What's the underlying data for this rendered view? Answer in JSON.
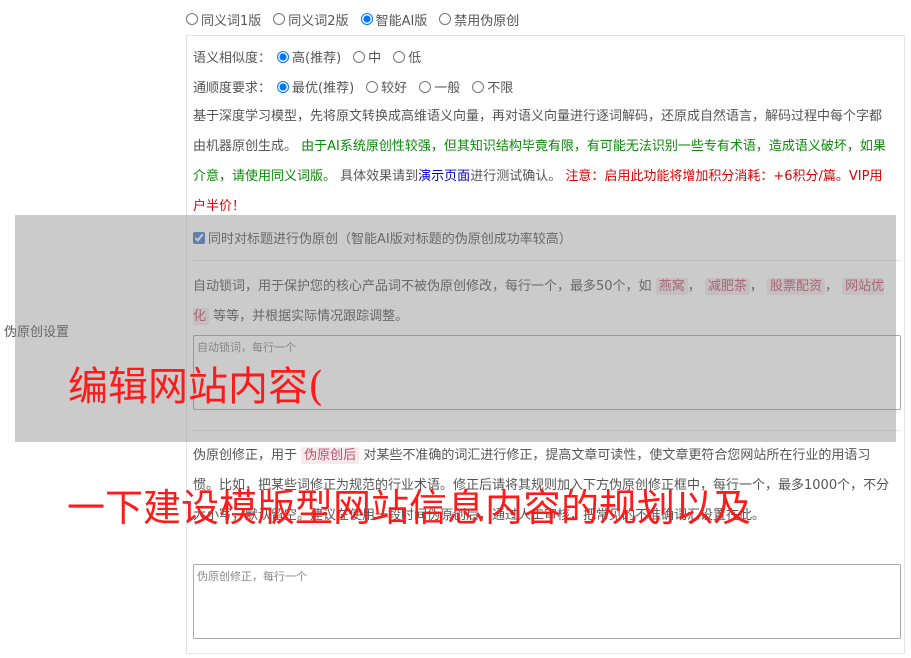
{
  "side_label": "伪原创设置",
  "versions": {
    "name": "version",
    "selected_index": 2,
    "options": [
      "同义词1版",
      "同义词2版",
      "智能AI版",
      "禁用伪原创"
    ]
  },
  "similarity": {
    "label": "语义相似度：",
    "selected_index": 0,
    "options": [
      "高(推荐)",
      "中",
      "低"
    ]
  },
  "fluency": {
    "label": "通顺度要求：",
    "selected_index": 0,
    "options": [
      "最优(推荐)",
      "较好",
      "一般",
      "不限"
    ]
  },
  "ai_desc": {
    "part1": "基于深度学习模型，先将原文转换成高维语义向量，再对语义向量进行逐词解码，还原成自然语言，解码过程中每个字都由机器原创生成。",
    "part2": "由于AI系统原创性较强，但其知识结构毕竟有限，有可能无法识别一些专有术语，造成语义破坏，如果介意，请使用同义词版。",
    "part3": "具体效果请到",
    "link": "演示页面",
    "part4": "进行测试确认。",
    "part5": "注意：启用此功能将增加积分消耗：+6积分/篇。VIP用户半价！"
  },
  "title_check": {
    "label": "同时对标题进行伪原创（智能AI版对标题的伪原创成功率较高）",
    "checked": true
  },
  "lock_words": {
    "desc_before": "自动锁词，用于保护您的核心产品词不被伪原创修改，每行一个，最多50个，如",
    "examples": [
      "燕窝",
      "减肥茶",
      "股票配资",
      "网站优化"
    ],
    "desc_after": "等等，并根据实际情况跟踪调整。",
    "placeholder": "自动锁词，每行一个"
  },
  "correction": {
    "desc_before": "伪原创修正，用于",
    "tag": "伪原创后",
    "desc_after": "对某些不准确的词汇进行修正，提高文章可读性，使文章更符合您网站所在行业的用语习惯。比如，把某些词修正为规范的行业术语。修正后请将其规则加入下方伪原创修正框中，每行一个，最多1000个，不分大小写，默认留空。建议在使用一段时间伪原创后，通过人工审核，把常见的不准确词汇设置在此。",
    "placeholder": "伪原创修正，每行一个"
  },
  "watermark": {
    "line1": "编辑网站内容(",
    "line2": "一下建设模版型网站信息内容的规划以及"
  }
}
